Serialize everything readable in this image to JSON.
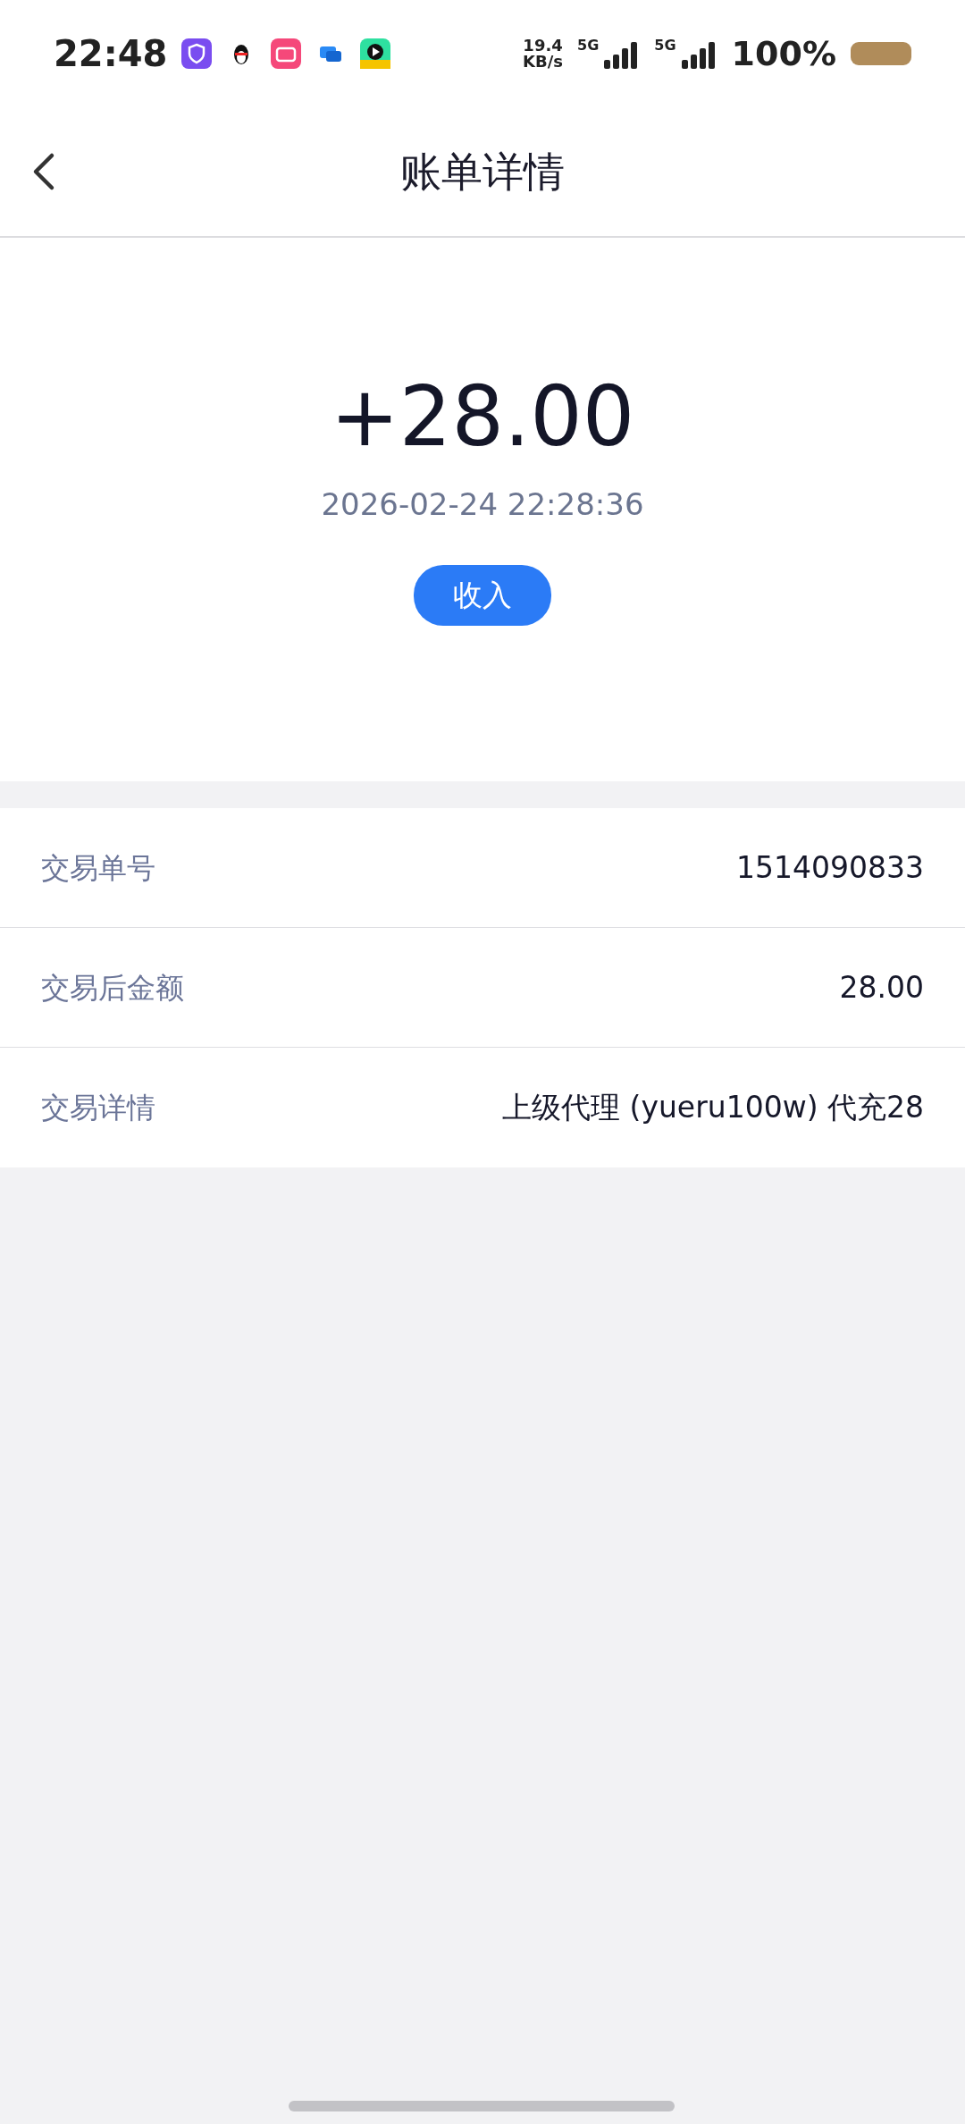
{
  "status_bar": {
    "time": "22:48",
    "net_speed": "19.4",
    "net_unit": "KB/s",
    "signals": [
      "5G",
      "5G"
    ],
    "battery": "100%"
  },
  "header": {
    "title": "账单详情"
  },
  "summary": {
    "amount": "+28.00",
    "datetime": "2026-02-24 22:28:36",
    "type_badge": "收入"
  },
  "details": [
    {
      "label": "交易单号",
      "value": "1514090833"
    },
    {
      "label": "交易后金额",
      "value": "28.00"
    },
    {
      "label": "交易详情",
      "value": "上级代理 (yueru100w) 代充28"
    }
  ]
}
